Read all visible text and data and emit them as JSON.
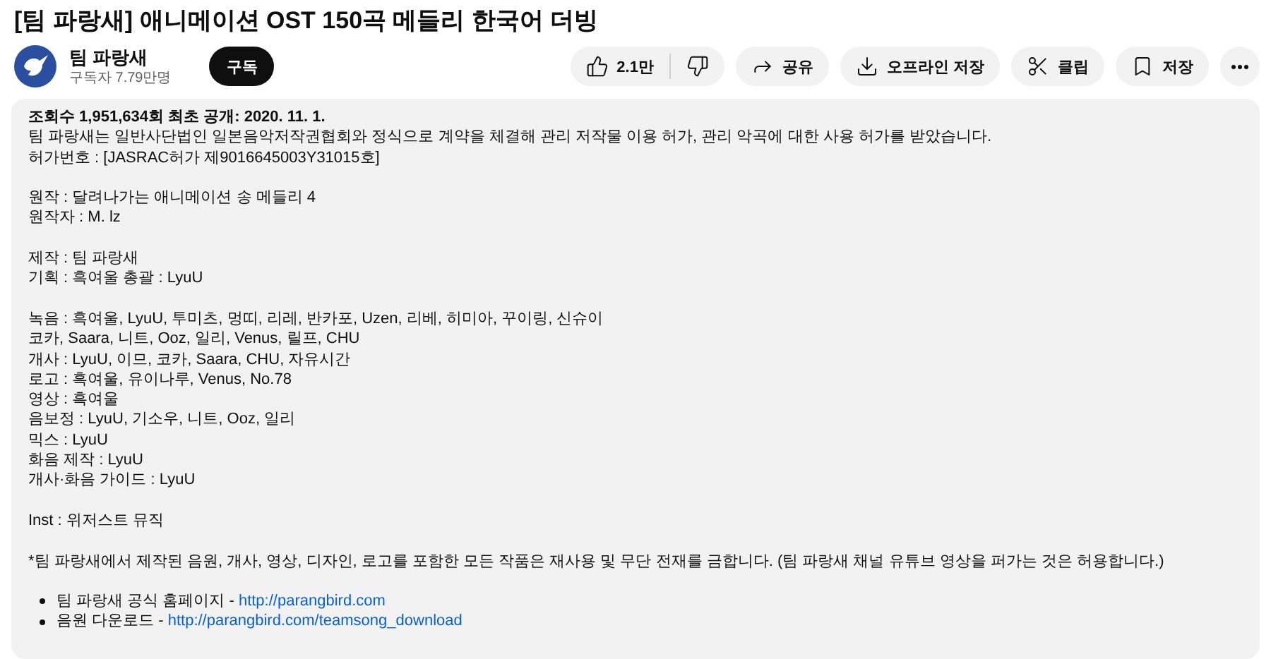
{
  "title": "[팀 파랑새] 애니메이션 OST 150곡 메들리 한국어 더빙",
  "channel": {
    "name": "팀 파랑새",
    "subscribers": "구독자 7.79만명",
    "subscribe": "구독"
  },
  "actions": {
    "likes": "2.1만",
    "buttons": [
      {
        "kind": "share",
        "label": "공유"
      },
      {
        "kind": "download",
        "label": "오프라인 저장"
      },
      {
        "kind": "clip",
        "label": "클립"
      },
      {
        "kind": "save",
        "label": "저장"
      }
    ]
  },
  "description": {
    "stats": "조회수 1,951,634회  최초 공개: 2020. 11. 1.",
    "blocks": [
      [
        "팀 파랑새는 일반사단법인 일본음악저작권협회와 정식으로 계약을 체결해 관리 저작물 이용 허가, 관리 악곡에 대한 사용 허가를 받았습니다.",
        "허가번호 : [JASRAC허가 제9016645003Y31015호]"
      ],
      [
        "원작 :  달려나가는 애니메이션 송 메들리 4",
        "원작자 : M. lz"
      ],
      [
        "제작 : 팀 파랑새",
        "기획 : 흑여울  총괄 : LyuU"
      ],
      [
        "녹음 : 흑여울, LyuU, 투미츠, 멍띠, 리레, 반카포, Uzen, 리베, 히미아, 꾸이링, 신슈이",
        "코카, Saara, 니트, Ooz, 일리, Venus, 릴프, CHU",
        "개사 : LyuU, 이므, 코카, Saara, CHU, 자유시간",
        "로고 : 흑여울, 유이나루, Venus, No.78",
        "영상 : 흑여울",
        "음보정 : LyuU, 기소우, 니트, Ooz, 일리",
        "믹스 : LyuU",
        "화음 제작 : LyuU",
        "개사·화음 가이드 : LyuU"
      ],
      [
        "Inst : 위저스트 뮤직"
      ],
      [
        "*팀 파랑새에서 제작된 음원, 개사, 영상, 디자인, 로고를 포함한 모든 작품은 재사용 및 무단 전재를 금합니다. (팀 파랑새 채널 유튜브 영상을 퍼가는 것은 허용합니다.)"
      ]
    ],
    "links": [
      {
        "text": "팀 파랑새 공식 홈페이지 - ",
        "url": "http://parangbird.com"
      },
      {
        "text": "음원 다운로드 - ",
        "url": "http://parangbird.com/teamsong_download"
      }
    ]
  }
}
